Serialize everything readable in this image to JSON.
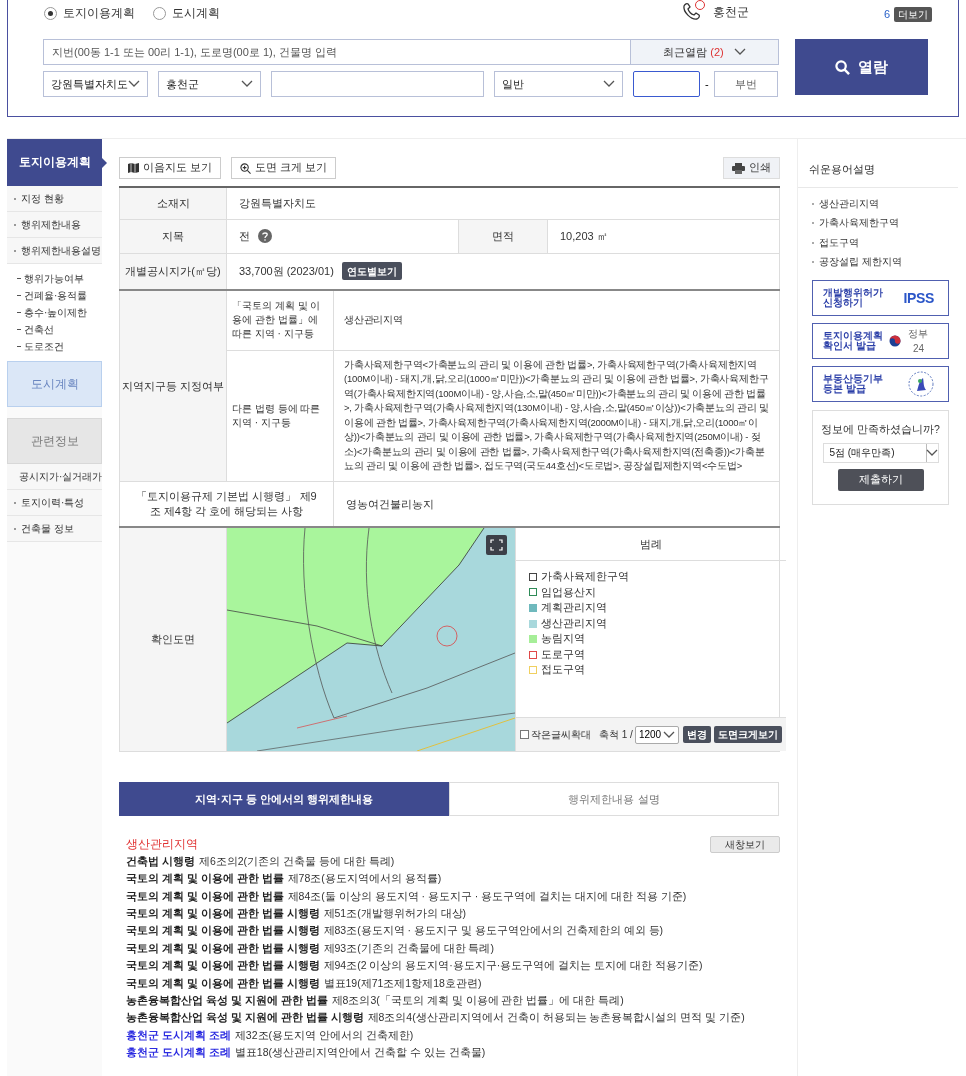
{
  "search": {
    "modes": [
      {
        "label": "토지이용계획",
        "selected": true
      },
      {
        "label": "도시계획",
        "selected": false
      }
    ],
    "notice": {
      "region": "홍천군",
      "count": "6",
      "more": "더보기"
    },
    "address_placeholder": "지번(00동 1-1 또는 00리 1-1), 도로명(00로 1), 건물명 입력",
    "recent": {
      "label": "최근열람",
      "count": "(2)"
    },
    "province": "강원특별자치도",
    "county": "홍천군",
    "land_type": "일반",
    "separator": "-",
    "sub_number_placeholder": "부번",
    "submit": "열람"
  },
  "sidebar": {
    "sections": [
      {
        "title": "토지이용계획",
        "selected": true,
        "kind": "link",
        "items": [
          {
            "label": "지정 현황"
          },
          {
            "label": "행위제한내용"
          },
          {
            "label": "행위제한내용설명",
            "children": [
              {
                "label": "행위가능여부"
              },
              {
                "label": "건폐율·용적률"
              },
              {
                "label": "층수·높이제한"
              },
              {
                "label": "건축선"
              },
              {
                "label": "도로조건"
              }
            ]
          }
        ]
      },
      {
        "title": "도시계획",
        "selected": false,
        "kind": "link"
      },
      {
        "title": "관련정보",
        "selected": false,
        "kind": "group",
        "items": [
          {
            "label": "공시지가·실거래가"
          },
          {
            "label": "토지이력·특성"
          },
          {
            "label": "건축물 정보"
          }
        ]
      }
    ]
  },
  "toolbar": {
    "buttons": [
      "이음지도 보기",
      "도면 크게 보기"
    ],
    "print": "인쇄"
  },
  "info": {
    "location_label": "소재지",
    "location": "강원특별자치도",
    "category_label": "지목",
    "category": "전",
    "area_label": "면적",
    "area": "10,203 ㎡",
    "price_label": "개별공시지가(㎡당)",
    "price": "33,700원 (2023/01)",
    "price_button": "연도별보기",
    "zones_label": "지역지구등 지정여부",
    "zones": [
      {
        "label": "「국토의 계획 및 이용에 관한 법률」에 따른 지역 · 지구등",
        "value": "생산관리지역"
      },
      {
        "label": "다른 법령 등에 따른 지역 · 지구등",
        "value": "가축사육제한구역<가축분뇨의 관리 및 이용에 관한 법률>, 가축사육제한구역(가축사육제한지역(100M이내) - 돼지,개,닭,오리(1000㎡미만))<가축분뇨의 관리 및 이용에 관한 법률>, 가축사육제한구역(가축사육제한지역(100M이내) - 양,사슴,소,말(450㎡미만))<가축분뇨의 관리 및 이용에 관한 법률>, 가축사육제한구역(가축사육제한지역(130M이내) - 양,사슴,소,말(450㎡이상))<가축분뇨의 관리 및 이용에 관한 법률>, 가축사육제한구역(가축사육제한지역(2000M이내) - 돼지,개,닭,오리(1000㎡이상))<가축분뇨의 관리 및 이용에 관한 법률>, 가축사육제한구역(가축사육제한지역(250M이내) - 젖소)<가축분뇨의 관리 및 이용에 관한 법률>, 가축사육제한구역(가축사육제한지역(전축종))<가축분뇨의 관리 및 이용에 관한 법률>, 접도구역(국도44호선)<도로법>, 공장설립제한지역<수도법>"
      }
    ],
    "regulation_label": "「토지이용규제 기본법 시행령」 제9조 제4항 각 호에 해당되는 사항",
    "regulation": "영농여건불리농지",
    "map_label": "확인도면"
  },
  "legend": {
    "title": "범례",
    "items": [
      {
        "label": "가축사육제한구역",
        "kind": "outline",
        "color": "#444444"
      },
      {
        "label": "임업용산지",
        "kind": "outline",
        "color": "#2e8b57"
      },
      {
        "label": "계획관리지역",
        "kind": "fill",
        "color": "#6fb9bd"
      },
      {
        "label": "생산관리지역",
        "kind": "fill",
        "color": "#a8d8dc"
      },
      {
        "label": "농림지역",
        "kind": "fill",
        "color": "#a6ee98"
      },
      {
        "label": "도로구역",
        "kind": "outline",
        "color": "#e04848"
      },
      {
        "label": "접도구역",
        "kind": "outline",
        "color": "#f0d060"
      }
    ],
    "enlarge_text": {
      "label": "작은글씨확대",
      "checked": false
    },
    "scale_label": "축척 1 /",
    "scale": "1200",
    "change": "변경",
    "big_map": "도면크게보기"
  },
  "tabs": [
    {
      "label": "지역·지구 등 안에서의 행위제한내용",
      "selected": true
    },
    {
      "label": "행위제한내용 설명",
      "selected": false
    }
  ],
  "restrictions": {
    "zone": "생산관리지역",
    "popup": "새창보기",
    "laws": [
      {
        "law": "건축법 시행령",
        "article": "제6조의2(기존의 건축물 등에 대한 특례)",
        "kind": "national"
      },
      {
        "law": "국토의 계획 및 이용에 관한 법률",
        "article": "제78조(용도지역에서의 용적률)",
        "kind": "national"
      },
      {
        "law": "국토의 계획 및 이용에 관한 법률",
        "article": "제84조(둘 이상의 용도지역 · 용도지구 · 용도구역에 걸치는 대지에 대한 적용 기준)",
        "kind": "national"
      },
      {
        "law": "국토의 계획 및 이용에 관한 법률 시행령",
        "article": "제51조(개발행위허가의 대상)",
        "kind": "national"
      },
      {
        "law": "국토의 계획 및 이용에 관한 법률 시행령",
        "article": "제83조(용도지역 · 용도지구 및 용도구역안에서의 건축제한의 예외 등)",
        "kind": "national"
      },
      {
        "law": "국토의 계획 및 이용에 관한 법률 시행령",
        "article": "제93조(기존의 건축물에 대한 특례)",
        "kind": "national"
      },
      {
        "law": "국토의 계획 및 이용에 관한 법률 시행령",
        "article": "제94조(2 이상의 용도지역·용도지구·용도구역에 걸치는 토지에 대한 적용기준)",
        "kind": "national"
      },
      {
        "law": "국토의 계획 및 이용에 관한 법률 시행령",
        "article": "별표19(제71조제1항제18호관련)",
        "kind": "national"
      },
      {
        "law": "농촌융복합산업 육성 및 지원에 관한 법률",
        "article": "제8조의3(「국토의 계획 및 이용에 관한 법률」에 대한 특례)",
        "kind": "national"
      },
      {
        "law": "농촌융복합산업 육성 및 지원에 관한 법률 시행령",
        "article": "제8조의4(생산관리지역에서 건축이 허용되는 농촌융복합시설의 면적 및 기준)",
        "kind": "national"
      },
      {
        "law": "홍천군 도시계획 조례",
        "article": "제32조(용도지역 안에서의 건축제한)",
        "kind": "local"
      },
      {
        "law": "홍천군 도시계획 조례",
        "article": "별표18(생산관리지역안에서 건축할 수 있는 건축물)",
        "kind": "local"
      }
    ]
  },
  "glossary": {
    "title": "쉬운용어설명",
    "terms": [
      "생산관리지역",
      "가축사육제한구역",
      "접도구역",
      "공장설립 제한지역"
    ]
  },
  "services": [
    {
      "label": "개발행위허가 신청하기",
      "kind": "ipss",
      "logo": "IPSS"
    },
    {
      "label": "토지이용계획 확인서 발급",
      "kind": "gov24",
      "logo": "정부24"
    },
    {
      "label": "부동산등기부등본 발급",
      "kind": "court"
    }
  ],
  "survey": {
    "question": "정보에 만족하셨습니까?",
    "value": "5점 (매우만족)",
    "submit": "제출하기"
  }
}
